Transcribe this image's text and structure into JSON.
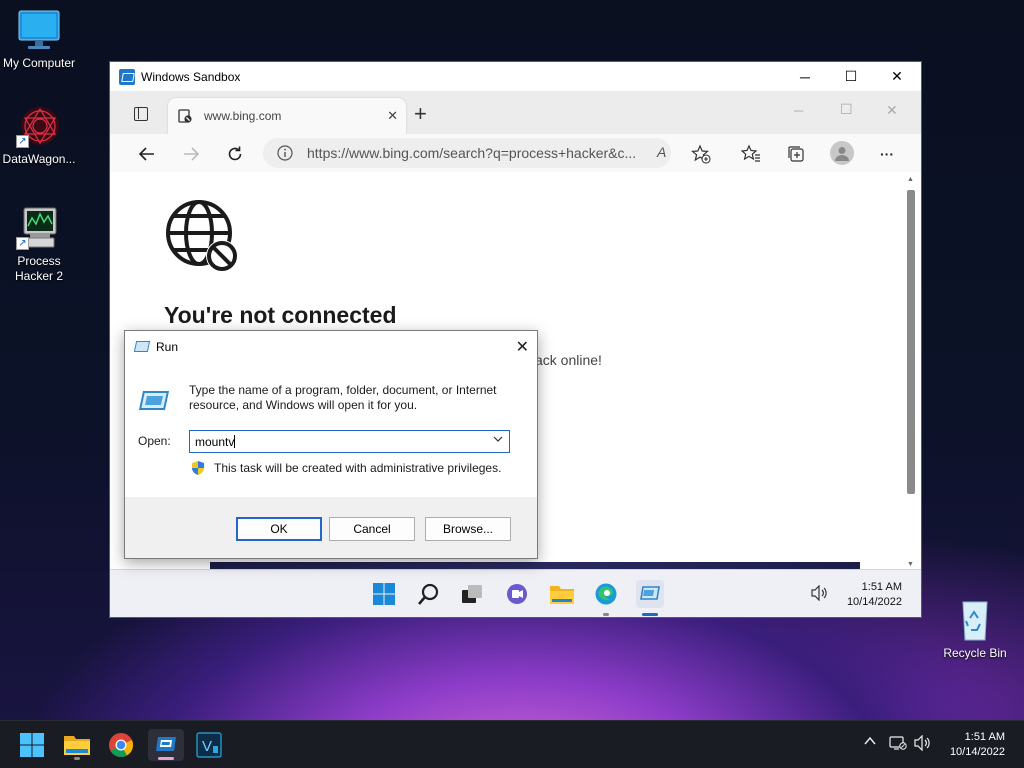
{
  "desktop": {
    "icons": [
      {
        "label": "My Computer"
      },
      {
        "label": "DataWagon..."
      },
      {
        "label": "Process Hacker 2"
      },
      {
        "label": "Recycle Bin"
      }
    ]
  },
  "sandbox": {
    "title": "Windows Sandbox",
    "controls": {
      "minimize": "─",
      "maximize": "☐",
      "close": "✕"
    }
  },
  "edge": {
    "tab_title": "www.bing.com",
    "tab_close": "✕",
    "new_tab": "+",
    "window_controls": {
      "minimize": "─",
      "maximize": "☐",
      "close": "✕"
    },
    "url": "https://www.bing.com/search?q=process+hacker&c...",
    "read_aloud": "A",
    "more": "···",
    "page": {
      "title": "You're not connected",
      "text_fragment": "ack online!"
    }
  },
  "guest_taskbar": {
    "time": "1:51 AM",
    "date": "10/14/2022"
  },
  "run_dialog": {
    "title": "Run",
    "close": "✕",
    "description": "Type the name of a program, folder, document, or Internet resource, and Windows will open it for you.",
    "open_label": "Open:",
    "input_value": "mountv",
    "admin_note": "This task will be created with administrative privileges.",
    "buttons": {
      "ok": "OK",
      "cancel": "Cancel",
      "browse": "Browse..."
    }
  },
  "host_taskbar": {
    "time": "1:51 AM",
    "date": "10/14/2022",
    "tray_chevron": "^"
  }
}
